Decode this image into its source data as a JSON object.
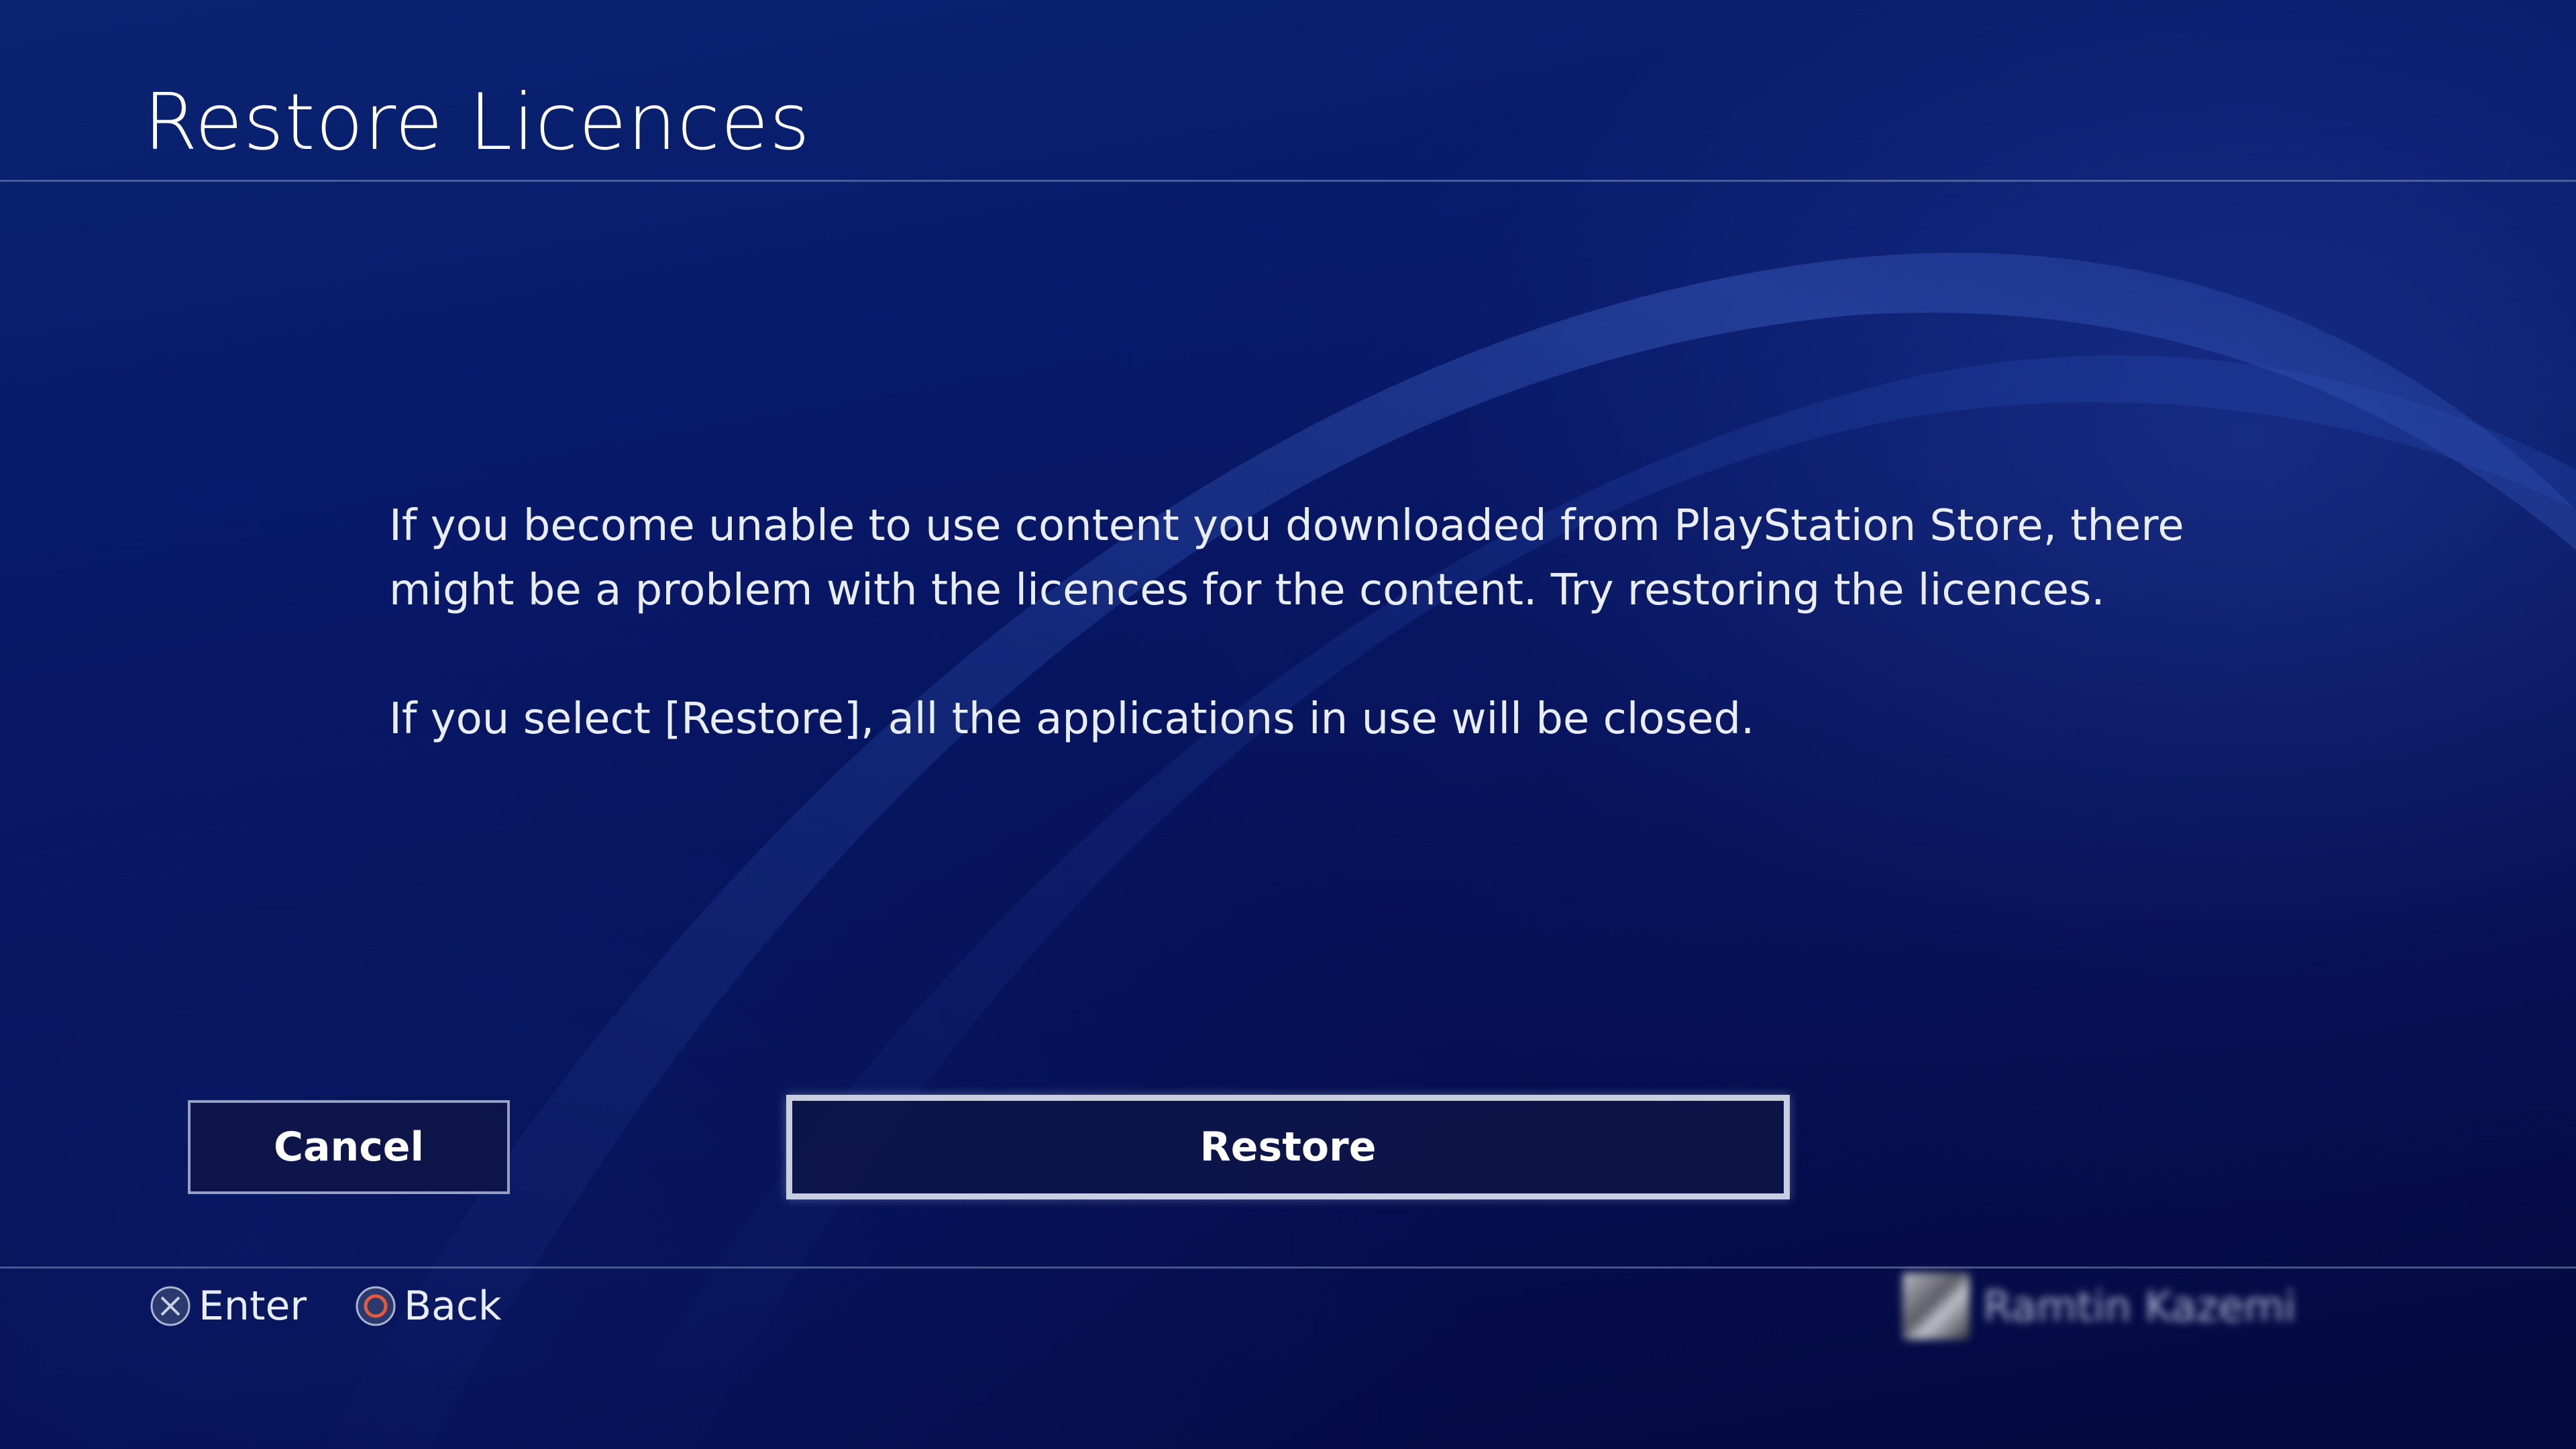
{
  "screen": {
    "title": "Restore Licences",
    "message": [
      "If you become unable to use content you downloaded from PlayStation Store, there might be a problem with the licences for the content. Try restoring the licences.",
      "If you select [Restore], all the applications in use will be closed."
    ]
  },
  "buttons": {
    "cancel_label": "Cancel",
    "restore_label": "Restore",
    "focused": "restore"
  },
  "footer": {
    "hints": [
      {
        "icon": "cross-button-icon",
        "label": "Enter"
      },
      {
        "icon": "circle-button-icon",
        "label": "Back"
      }
    ],
    "user": {
      "name": "Ramtin Kazemi",
      "avatar": "user-avatar"
    }
  },
  "colors": {
    "background": "#06124a",
    "circle_button": "#e8583a",
    "focus_border": "#c8cedf"
  }
}
